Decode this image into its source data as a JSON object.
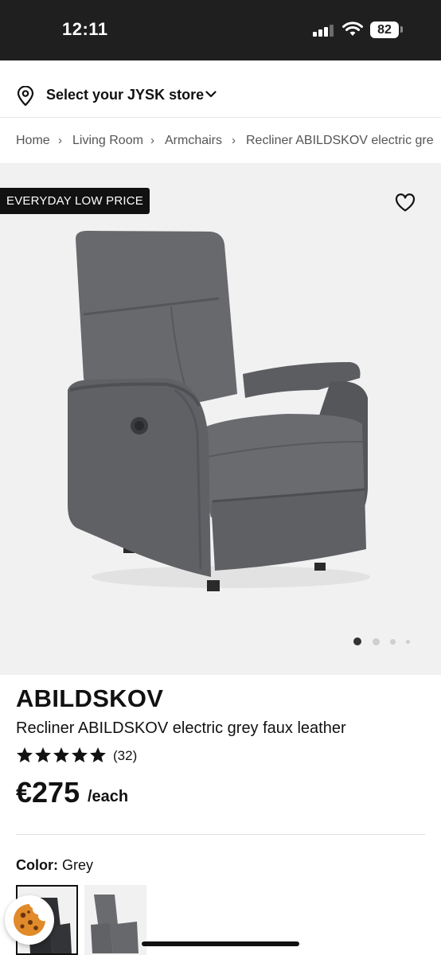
{
  "status_bar": {
    "time": "12:11",
    "battery": "82"
  },
  "store": {
    "label": "Select your JYSK store",
    "icon": "map-pin-icon"
  },
  "breadcrumb": [
    "Home",
    "Living Room",
    "Armchairs",
    "Recliner ABILDSKOV electric gre"
  ],
  "gallery": {
    "badge": "EVERYDAY LOW PRICE",
    "image_count": 4,
    "active_image": 1
  },
  "product": {
    "name": "ABILDSKOV",
    "description": "Recliner ABILDSKOV electric grey faux leather",
    "rating": 5,
    "review_count": "(32)",
    "price": "€275",
    "unit": "/each",
    "color_label": "Color:",
    "color_value": "Grey"
  },
  "colors": {
    "accent": "#111111",
    "gallery_bg": "#f1f1f1",
    "chair": "#5c5d61"
  }
}
